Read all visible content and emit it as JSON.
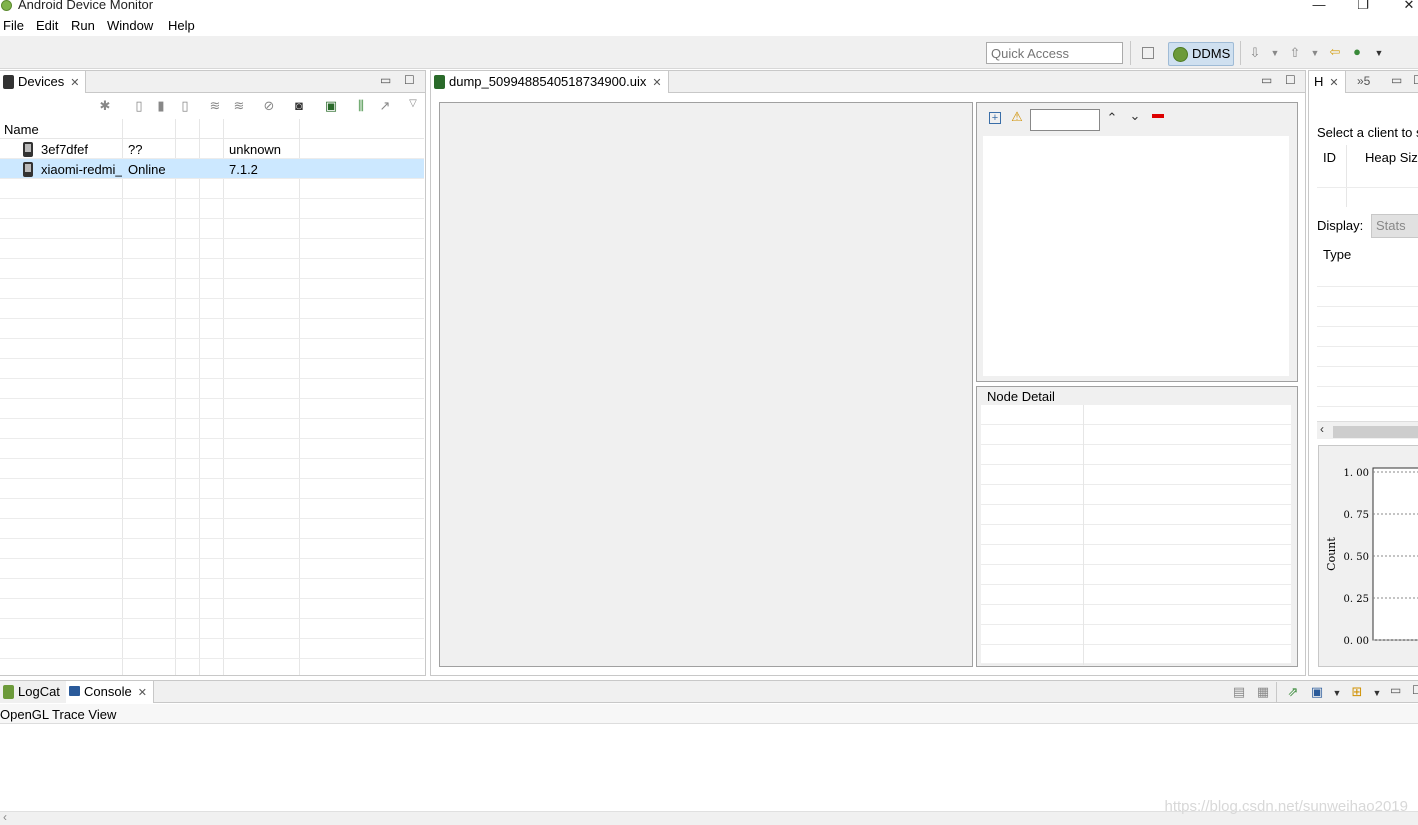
{
  "window": {
    "title": "Android Device Monitor",
    "minimize": "—",
    "restore": "❐",
    "close": "✕"
  },
  "menu": [
    "File",
    "Edit",
    "Run",
    "Window",
    "Help"
  ],
  "toolbar": {
    "quick_access_placeholder": "Quick Access",
    "perspective": "DDMS"
  },
  "devices_view": {
    "tab_label": "Devices",
    "column_name": "Name",
    "rows": [
      {
        "name": "3ef7dfef",
        "state": "??",
        "version": "unknown",
        "selected": false
      },
      {
        "name": "xiaomi-redmi_",
        "state": "Online",
        "version": "7.1.2",
        "selected": true
      }
    ]
  },
  "editor": {
    "tab_label": "dump_5099488540518734900.uix",
    "node_detail_title": "Node Detail"
  },
  "heap_view": {
    "tab_label": "H",
    "overflow_label": "»5",
    "select_client_text": "Select a client to s",
    "col_id": "ID",
    "col_heap": "Heap Size",
    "display_label": "Display:",
    "display_value": "Stats",
    "type_header": "Type",
    "count_label": "Count",
    "y_ticks": [
      "1. 00",
      "0. 75",
      "0. 50",
      "0. 25",
      "0. 00"
    ]
  },
  "bottom": {
    "tab_logcat": "LogCat",
    "tab_console": "Console",
    "console_title": "OpenGL Trace View"
  },
  "watermark": "https://blog.csdn.net/sunweihao2019"
}
